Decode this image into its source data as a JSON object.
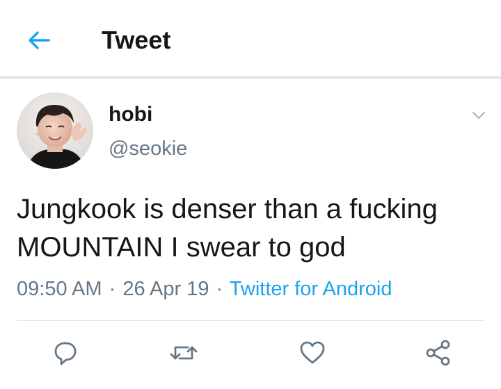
{
  "header": {
    "title": "Tweet",
    "back_icon": "arrow-left-icon",
    "accent": "#1da1f2"
  },
  "tweet": {
    "author": {
      "display_name": "hobi",
      "handle": "@seokie"
    },
    "text": "Jungkook is denser than a fucking MOUNTAIN I swear to god",
    "time": "09:50 AM",
    "date": "26 Apr 19",
    "separator": "·",
    "source": "Twitter for Android"
  },
  "actions": [
    {
      "name": "reply",
      "icon": "reply-icon"
    },
    {
      "name": "retweet",
      "icon": "retweet-icon"
    },
    {
      "name": "like",
      "icon": "heart-icon"
    },
    {
      "name": "share",
      "icon": "share-icon"
    }
  ],
  "colors": {
    "text_primary": "#14171a",
    "text_secondary": "#657786",
    "link": "#1da1f2",
    "divider": "#e1e8ed"
  }
}
